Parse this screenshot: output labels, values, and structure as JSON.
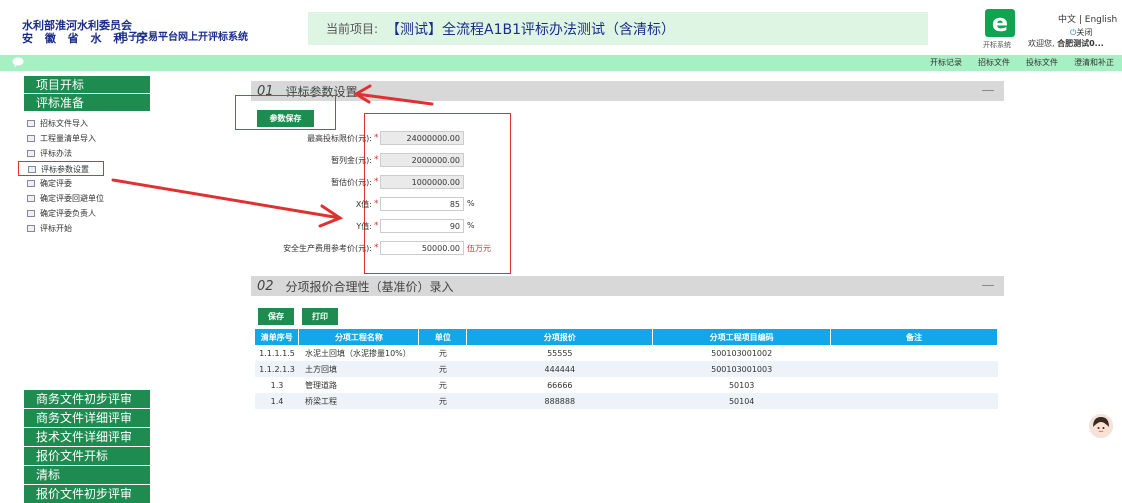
{
  "header": {
    "org_line1": "水利部淮河水利委员会",
    "org_line2": "安 徽 省 水 利 厅",
    "system_name": "电子交易平台网上开评标系统",
    "project_label": "当前项目:",
    "project_name": "【测试】全流程A1B1评标办法测试（含清标）",
    "logo_letter": "e",
    "logo_caption": "开标系统",
    "lang": "中文 | English",
    "close_label": "关闭",
    "welcome": "欢迎您,",
    "user": "合肥测试0..."
  },
  "nav": {
    "links": [
      "开标记录",
      "招标文件",
      "投标文件",
      "澄清和补正"
    ]
  },
  "sidebar": {
    "top_sections": [
      "项目开标",
      "评标准备"
    ],
    "items": [
      "招标文件导入",
      "工程量清单导入",
      "评标办法",
      "评标参数设置",
      "确定评委",
      "确定评委回避单位",
      "确定评委负责人",
      "评标开始"
    ],
    "selected_index": 3,
    "bottom_sections": [
      "商务文件初步评审",
      "商务文件详细评审",
      "技术文件详细评审",
      "报价文件开标",
      "清标",
      "报价文件初步评审"
    ]
  },
  "section1": {
    "num": "01",
    "title": "评标参数设置",
    "save_label": "参数保存",
    "fields": [
      {
        "label": "最高投标限价(元):",
        "value": "24000000.00",
        "unit": ""
      },
      {
        "label": "暂列金(元):",
        "value": "2000000.00",
        "unit": ""
      },
      {
        "label": "暂估价(元):",
        "value": "1000000.00",
        "unit": ""
      },
      {
        "label": "X值:",
        "value": "85",
        "unit": "%"
      },
      {
        "label": "Y值:",
        "value": "90",
        "unit": "%"
      },
      {
        "label": "安全生产费用参考价(元):",
        "value": "50000.00",
        "unit": "伍万元"
      }
    ]
  },
  "section2": {
    "num": "02",
    "title": "分项报价合理性（基准价）录入",
    "save_label": "保存",
    "print_label": "打印",
    "columns": [
      "清单序号",
      "分项工程名称",
      "单位",
      "分项报价",
      "分项工程项目编码",
      "备注"
    ],
    "rows": [
      [
        "1.1.1.1.5",
        "水泥土回填（水泥掺量10%）",
        "元",
        "55555",
        "500103001002",
        ""
      ],
      [
        "1.1.2.1.3",
        "土方回填",
        "元",
        "444444",
        "500103001003",
        ""
      ],
      [
        "1.3",
        "管理道路",
        "元",
        "66666",
        "50103",
        ""
      ],
      [
        "1.4",
        "桥梁工程",
        "元",
        "888888",
        "50104",
        ""
      ]
    ]
  },
  "colors": {
    "brand_green": "#1e8c50",
    "nav_mint": "#a7f0c4",
    "table_header": "#12a8e8",
    "annotation_red": "#e03030"
  }
}
